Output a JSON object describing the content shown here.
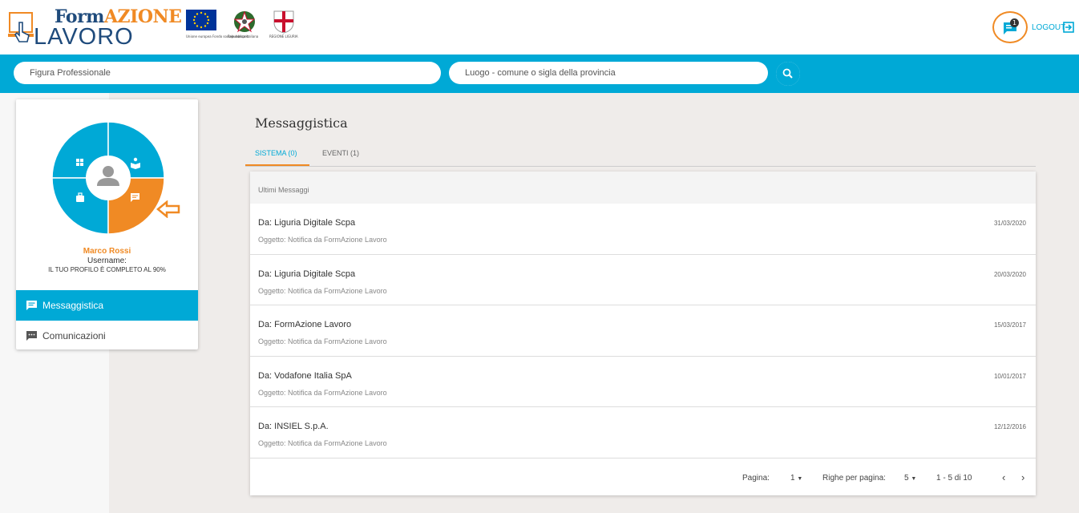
{
  "header": {
    "logo_word1": "Form",
    "logo_word2": "AZIONE",
    "logo_word3": "LAVORO",
    "partners": {
      "eu_caption": "Unione europea Fondo sociale europeo",
      "it_caption": "Repubblica Italiana",
      "lig_caption": "REGIONE LIGURIA"
    },
    "notification_count": "1",
    "logout_label": "LOGOUT"
  },
  "search": {
    "profession_placeholder": "Figura Professionale",
    "place_placeholder": "Luogo - comune o sigla della provincia"
  },
  "profile": {
    "name": "Marco Rossi",
    "username_label": "Username:",
    "completion": "IL TUO PROFILO È COMPLETO AL 90%"
  },
  "sidebar": {
    "items": [
      {
        "label": "Messaggistica",
        "icon": "message-icon",
        "active": true
      },
      {
        "label": "Comunicazioni",
        "icon": "chat-icon",
        "active": false
      }
    ]
  },
  "main": {
    "title": "Messaggistica",
    "tabs": [
      {
        "label": "SISTEMA (0)",
        "active": true
      },
      {
        "label": "EVENTI (1)",
        "active": false
      }
    ],
    "list_header": "Ultimi Messaggi",
    "messages": [
      {
        "from": "Da: Liguria Digitale Scpa",
        "subject": "Oggetto: Notifica da FormAzione Lavoro",
        "date": "31/03/2020"
      },
      {
        "from": "Da: Liguria Digitale Scpa",
        "subject": "Oggetto: Notifica da FormAzione Lavoro",
        "date": "20/03/2020"
      },
      {
        "from": "Da: FormAzione Lavoro",
        "subject": "Oggetto: Notifica da FormAzione Lavoro",
        "date": "15/03/2017"
      },
      {
        "from": "Da: Vodafone Italia SpA",
        "subject": "Oggetto: Notifica da FormAzione Lavoro",
        "date": "10/01/2017"
      },
      {
        "from": "Da: INSIEL S.p.A.",
        "subject": "Oggetto: Notifica da FormAzione Lavoro",
        "date": "12/12/2016"
      }
    ],
    "pagination": {
      "page_label": "Pagina:",
      "page_value": "1",
      "rows_label": "Righe per pagina:",
      "rows_value": "5",
      "range": "1 - 5 di 10"
    }
  },
  "colors": {
    "accent": "#00a9d6",
    "highlight": "#f08a24",
    "brand": "#1f4b7c"
  }
}
